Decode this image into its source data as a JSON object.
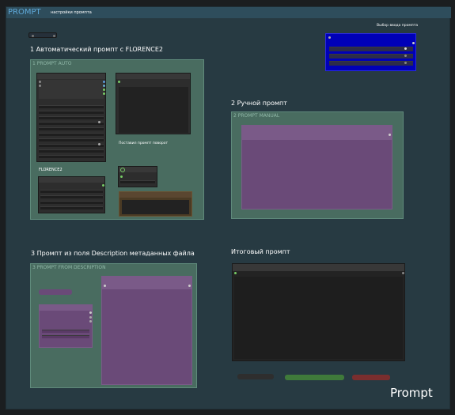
{
  "header": {
    "title": "PROMPT",
    "subtitle": "настройки промпта"
  },
  "sections": {
    "auto": "1 Автоматический промпт с FLORENCE2",
    "manual": "2 Ручной промпт",
    "description": "3 Промпт из поля Description метаданных файла",
    "final": "Итоговый промпт"
  },
  "groups": {
    "auto": "1 PROMPT AUTO",
    "manual": "2 PROMPT MANUAL",
    "description": "3 PROMPT FROM DESCRIPTION"
  },
  "labels": {
    "florence": "FLORENCE2",
    "rotate_note": "Поставил промпт поворот",
    "prompt_choice": "Выбор ввода промпта"
  },
  "watermark": "Prompt",
  "colors": {
    "workspace": "#273a42",
    "group_green": "#496c60",
    "node_dark": "#2d2d2d",
    "node_purple": "#6a4a78",
    "selector_blue": "#0000c0",
    "accent_title": "#5fa8d8"
  }
}
